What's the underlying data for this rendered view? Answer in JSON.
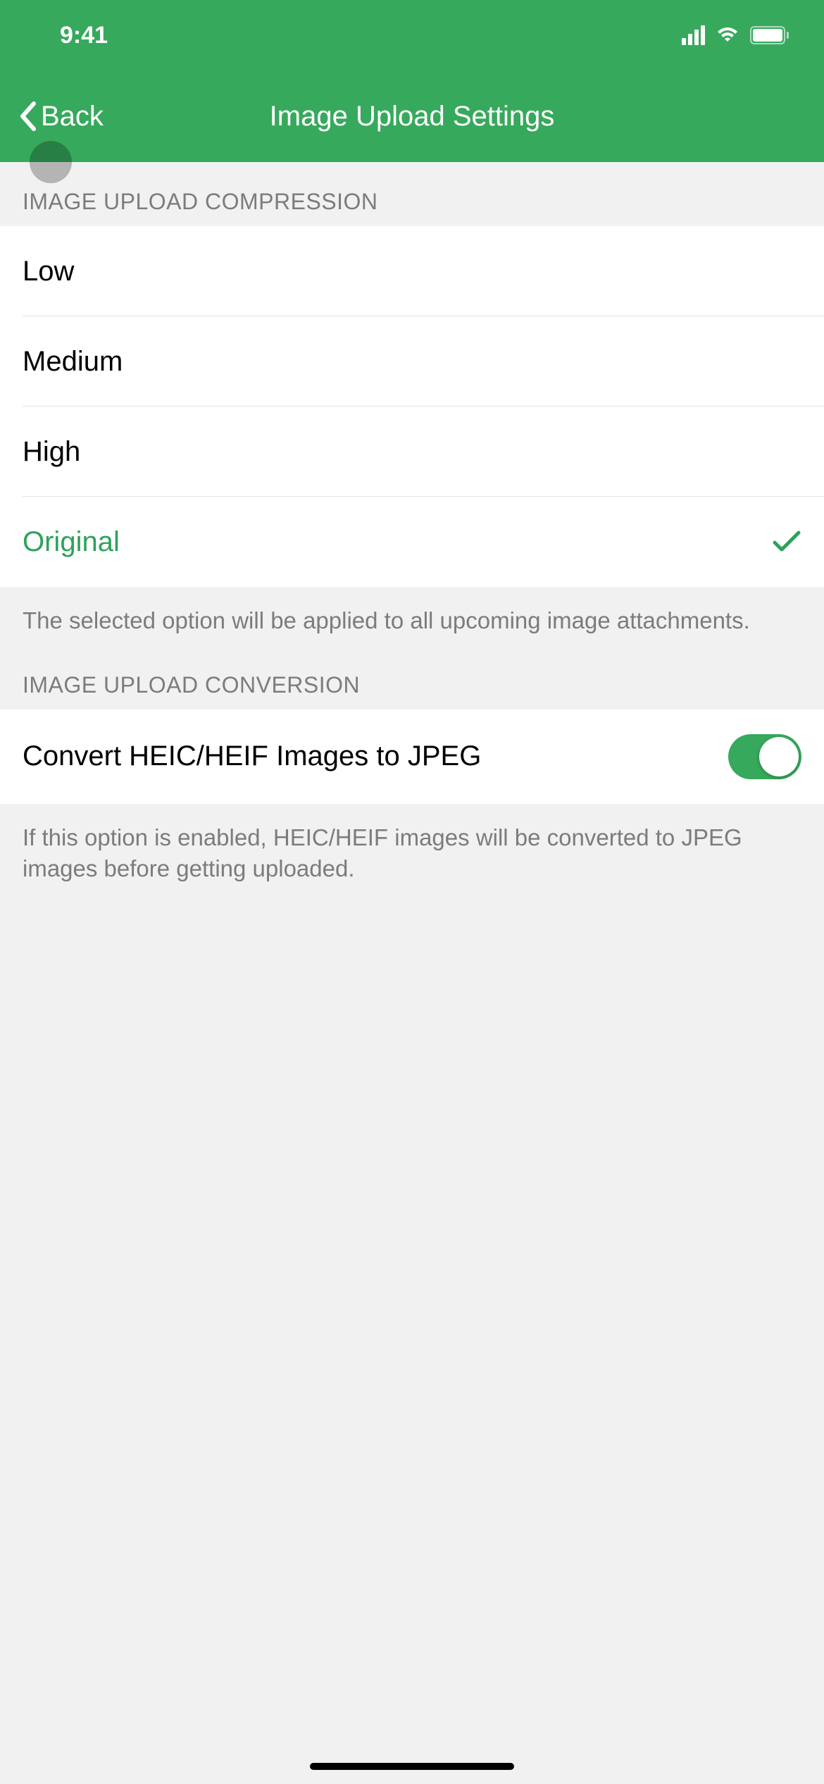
{
  "statusBar": {
    "time": "9:41"
  },
  "nav": {
    "backLabel": "Back",
    "title": "Image Upload Settings"
  },
  "compressionSection": {
    "header": "Image Upload Compression",
    "options": [
      {
        "label": "Low",
        "selected": false
      },
      {
        "label": "Medium",
        "selected": false
      },
      {
        "label": "High",
        "selected": false
      },
      {
        "label": "Original",
        "selected": true
      }
    ],
    "footer": "The selected option will be applied to all upcoming image attachments."
  },
  "conversionSection": {
    "header": "Image Upload Conversion",
    "toggle": {
      "label": "Convert HEIC/HEIF Images to JPEG",
      "enabled": true
    },
    "footer": "If this option is enabled, HEIC/HEIF images will be converted to JPEG images before getting uploaded."
  },
  "colors": {
    "accent": "#37a95c"
  }
}
